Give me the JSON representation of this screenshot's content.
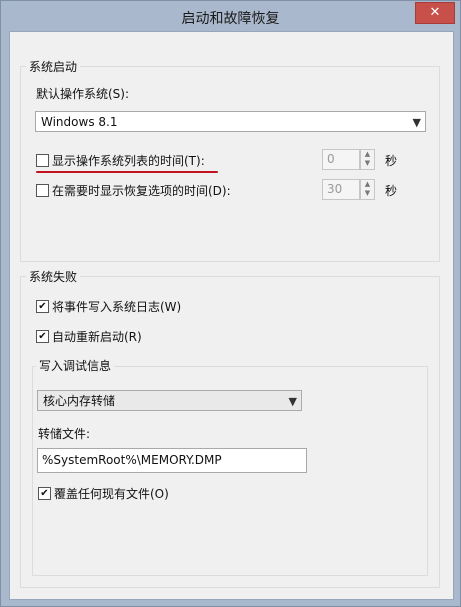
{
  "window": {
    "title": "启动和故障恢复",
    "close_glyph": "✕"
  },
  "system_startup": {
    "group_label": "系统启动",
    "default_os_label": "默认操作系统(S):",
    "default_os_value": "Windows 8.1",
    "show_os_list": {
      "label": "显示操作系统列表的时间(T):",
      "checked": false,
      "value": "0",
      "unit": "秒"
    },
    "show_recovery": {
      "label": "在需要时显示恢复选项的时间(D):",
      "checked": false,
      "value": "30",
      "unit": "秒"
    }
  },
  "system_failure": {
    "group_label": "系统失败",
    "write_event": {
      "label": "将事件写入系统日志(W)",
      "checked": true
    },
    "auto_restart": {
      "label": "自动重新启动(R)",
      "checked": true
    },
    "debug_info": {
      "group_label": "写入调试信息",
      "dump_type": "核心内存转储",
      "dump_file_label": "转储文件:",
      "dump_file_value": "%SystemRoot%\\MEMORY.DMP",
      "overwrite": {
        "label": "覆盖任何现有文件(O)",
        "checked": true
      }
    }
  },
  "check_glyph": "✔",
  "dropdown_glyph": "▼",
  "spin_up_glyph": "▲",
  "spin_down_glyph": "▼",
  "annotation_color": "#c1121f"
}
